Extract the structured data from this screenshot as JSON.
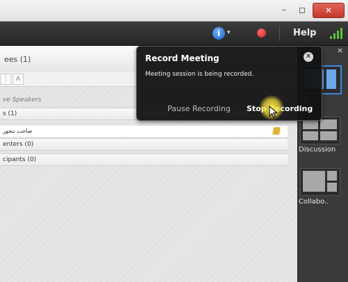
{
  "window": {
    "minimize": "–",
    "maximize": "◻",
    "close": "✕"
  },
  "toolbar": {
    "info_icon": "i",
    "caret": "▾",
    "help_label": "Help"
  },
  "attendees": {
    "title": "ees (1)",
    "sort_az": "A",
    "active_speakers": "ve Speakers",
    "hosts_group": "s (1)",
    "host_user": "ﺻﺎﺣﺐ ﺑﻨﺠﻮﺭ",
    "presenters_group": "enters (0)",
    "participants_group": "cipants (0)"
  },
  "layouts": {
    "close": "×",
    "items": [
      {
        "label": "ng",
        "active": true
      },
      {
        "label": "Discussion",
        "active": false
      },
      {
        "label": "Collabo..",
        "active": false
      }
    ]
  },
  "popup": {
    "title": "Record Meeting",
    "message": "Meeting session is being recorded.",
    "close_icon": "✕",
    "pause_label": "Pause Recording",
    "stop_label": "Stop Recording"
  }
}
